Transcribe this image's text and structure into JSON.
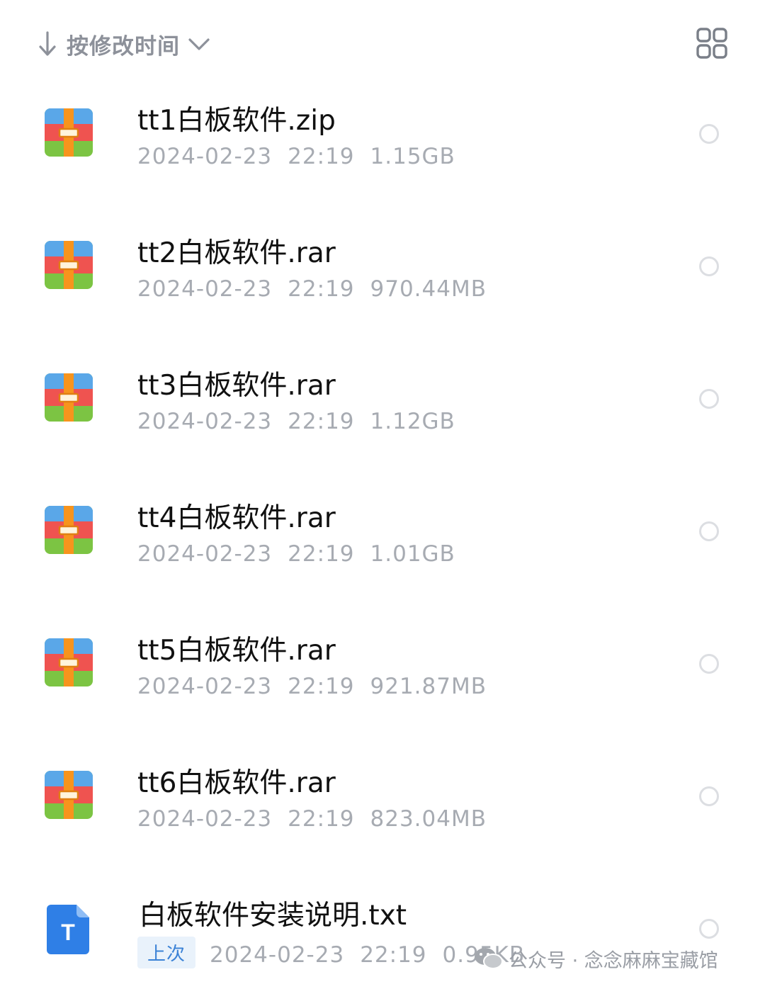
{
  "sortbar": {
    "sort_label": "按修改时间",
    "arrow_icon": "arrow-down-icon",
    "chevron_icon": "chevron-down-icon",
    "view_toggle_icon": "grid-view-icon"
  },
  "files": [
    {
      "name": "tt1白板软件.zip",
      "date": "2024-02-23",
      "time": "22:19",
      "size": "1.15GB",
      "icon": "archive-icon"
    },
    {
      "name": "tt2白板软件.rar",
      "date": "2024-02-23",
      "time": "22:19",
      "size": "970.44MB",
      "icon": "archive-icon"
    },
    {
      "name": "tt3白板软件.rar",
      "date": "2024-02-23",
      "time": "22:19",
      "size": "1.12GB",
      "icon": "archive-icon"
    },
    {
      "name": "tt4白板软件.rar",
      "date": "2024-02-23",
      "time": "22:19",
      "size": "1.01GB",
      "icon": "archive-icon"
    },
    {
      "name": "tt5白板软件.rar",
      "date": "2024-02-23",
      "time": "22:19",
      "size": "921.87MB",
      "icon": "archive-icon"
    },
    {
      "name": "tt6白板软件.rar",
      "date": "2024-02-23",
      "time": "22:19",
      "size": "823.04MB",
      "icon": "archive-icon"
    },
    {
      "name": "白板软件安装说明.txt",
      "badge": "上次",
      "date": "2024-02-23",
      "time": "22:19",
      "size": "0.95KB",
      "icon": "text-file-icon",
      "icon_letter": "T"
    }
  ],
  "watermark": {
    "text": "公众号 · 念念麻麻宝藏馆",
    "icon": "wechat-icon"
  },
  "colors": {
    "name_text": "#111111",
    "meta_text": "#a7abb2",
    "sort_text": "#8d919a",
    "badge_bg": "#e9f2fb",
    "badge_text": "#3b82d6",
    "archive_top": "#5aa7e8",
    "archive_middle": "#ef5350",
    "archive_bottom": "#7cc443",
    "archive_strap": "#f7941d",
    "txt_icon": "#2f7fe6"
  }
}
